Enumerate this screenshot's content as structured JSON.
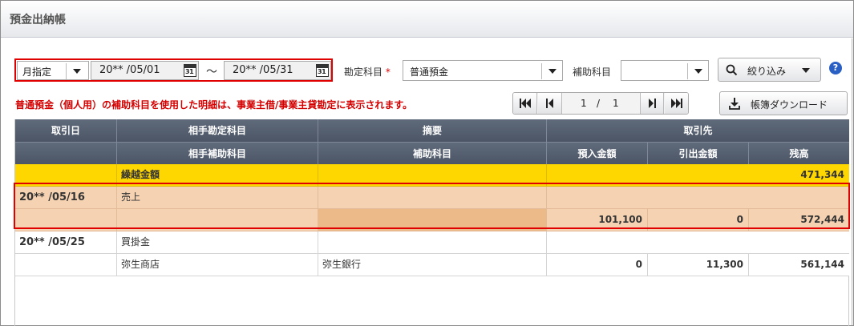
{
  "page": {
    "title": "預金出納帳"
  },
  "filter": {
    "period_mode": "月指定",
    "date_from": "20** /05/01",
    "date_to": "20** /05/31",
    "range_sep": "〜",
    "calendar_day": "31",
    "account_label": "勘定科目",
    "required_mark": "*",
    "account_value": "普通預金",
    "sub_label": "補助科目",
    "sub_value": "",
    "filter_button": "絞り込み",
    "help": "?"
  },
  "notice": "普通預金（個人用）の補助科目を使用した明細は、事業主借/事業主貸勘定に表示されます。",
  "pager": {
    "current": "1",
    "sep": "/",
    "total": "1"
  },
  "download_button": "帳簿ダウンロード",
  "table": {
    "header_row1": [
      "取引日",
      "相手勘定科目",
      "摘要",
      "取引先"
    ],
    "header_row2": [
      "",
      "相手補助科目",
      "補助科目",
      "預入金額",
      "引出金額",
      "残高"
    ],
    "carryover": {
      "label": "繰越金額",
      "balance": "471,344"
    },
    "entries": [
      {
        "date": "20** /05/16",
        "account": "売上",
        "memo": "",
        "partner": "",
        "sub_account": "",
        "sub_item": "",
        "deposit": "101,100",
        "withdrawal": "0",
        "balance": "572,444"
      },
      {
        "date": "20** /05/25",
        "account": "買掛金",
        "memo": "",
        "partner": "",
        "sub_account": "弥生商店",
        "sub_item": "弥生銀行",
        "deposit": "0",
        "withdrawal": "11,300",
        "balance": "561,144"
      }
    ]
  }
}
